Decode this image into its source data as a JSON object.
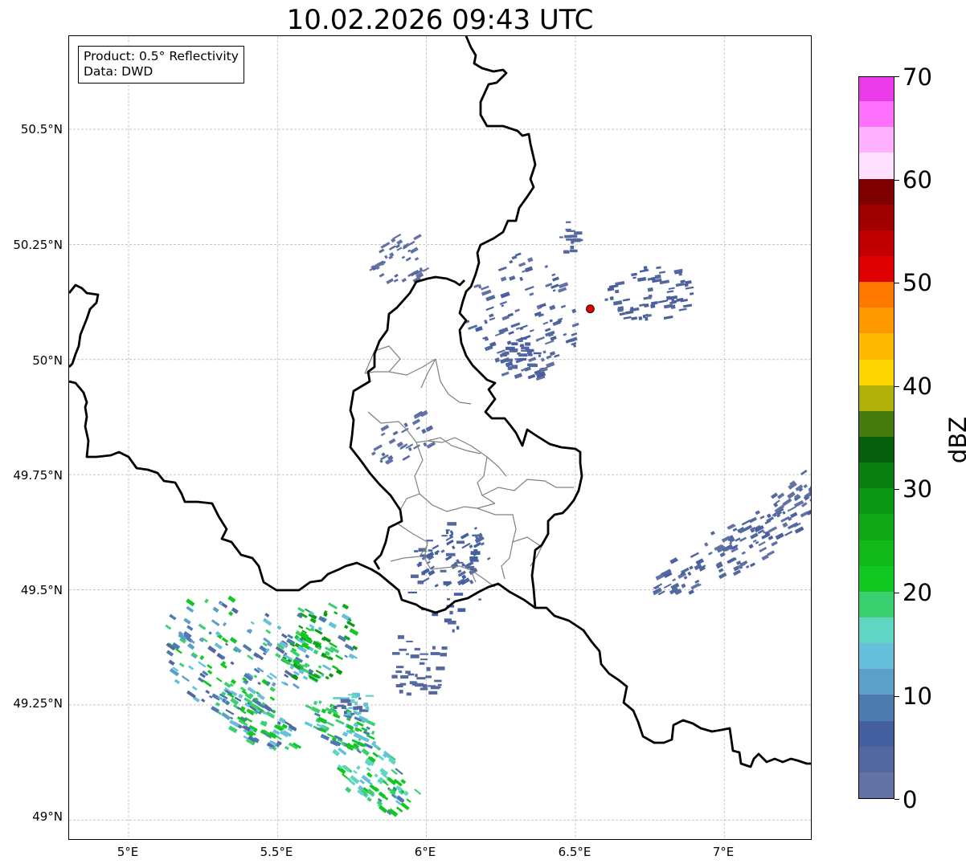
{
  "title": "10.02.2026 09:43 UTC",
  "info": {
    "product": "Product: 0.5° Reflectivity",
    "source": "Data: DWD"
  },
  "axes": {
    "lon_ticks": [
      {
        "value": 5.0,
        "label": "5°E"
      },
      {
        "value": 5.5,
        "label": "5.5°E"
      },
      {
        "value": 6.0,
        "label": "6°E"
      },
      {
        "value": 6.5,
        "label": "6.5°E"
      },
      {
        "value": 7.0,
        "label": "7°E"
      }
    ],
    "lat_ticks": [
      {
        "value": 50.5,
        "label": "50.5°N"
      },
      {
        "value": 50.25,
        "label": "50.25°N"
      },
      {
        "value": 50.0,
        "label": "50°N"
      },
      {
        "value": 49.75,
        "label": "49.75°N"
      },
      {
        "value": 49.5,
        "label": "49.5°N"
      },
      {
        "value": 49.25,
        "label": "49.25°N"
      },
      {
        "value": 49.0,
        "label": "49°N"
      }
    ],
    "gridlines": true
  },
  "radar_site": {
    "lat": 50.11,
    "lon": 6.55,
    "color": "#e00000"
  },
  "colorbar": {
    "title": "dBZ",
    "min": 0,
    "max": 70,
    "tick_labels": [
      "0",
      "10",
      "20",
      "30",
      "40",
      "50",
      "60",
      "70"
    ],
    "colors": [
      "#6272a4",
      "#53689e",
      "#4460a0",
      "#4c7bb0",
      "#5aa0c8",
      "#66c0dc",
      "#5fd6c4",
      "#3ad070",
      "#10c820",
      "#10b818",
      "#10a814",
      "#0c9814",
      "#0a8012",
      "#065f0c",
      "#477a0c",
      "#b0b20a",
      "#fed700",
      "#fdb800",
      "#fe9800",
      "#ff7800",
      "#e00000",
      "#c00000",
      "#a00000",
      "#7f0000",
      "#ffe0ff",
      "#ffb0ff",
      "#ff70ff",
      "#ea3aea"
    ]
  },
  "colors": {
    "border_country": "#000000",
    "border_region": "#808080",
    "grid": "#b4b4b4"
  }
}
